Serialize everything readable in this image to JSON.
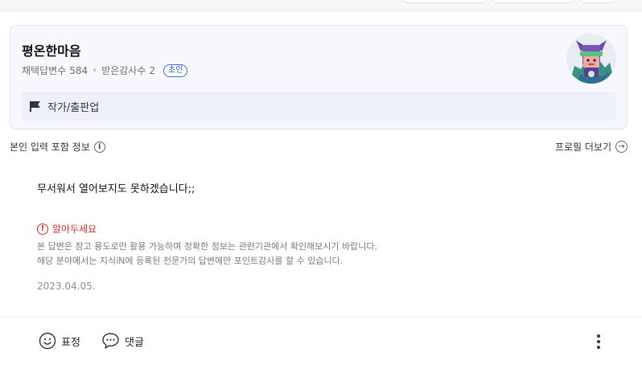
{
  "profile": {
    "name": "평온한마음",
    "adopted_label": "채택답변수",
    "adopted_count": "584",
    "thanks_label": "받은감사수",
    "thanks_count": "2",
    "rank_badge": "초인",
    "category": "작가/출판업",
    "category_icon": "flag-icon",
    "avatar": "character-avatar"
  },
  "info": {
    "self_input_label": "본인 입력 포함 정보",
    "info_icon": "info-icon",
    "more_profile_label": "프로필 더보기",
    "more_icon": "arrow-right-circle-icon"
  },
  "answer": {
    "body": "무서워서 열어보지도 못하겠습니다;;",
    "notice_title": "알아두세요",
    "notice_line1": "본 답변은 참고 용도로만 활용 가능하며 정확한 정보는 관련기관에서 확인해보시기 바랍니다.",
    "notice_line2": "해당 분야에서는 지식iN에 등록된 전문가의 답변에만 포인트감사를 할 수 있습니다.",
    "date": "2023.04.05."
  },
  "actions": {
    "emotion_label": "표정",
    "comment_label": "댓글",
    "emotion_icon": "smile-icon",
    "comment_icon": "speech-bubble-icon",
    "more_icon": "kebab-menu-icon"
  },
  "colors": {
    "warning": "#d9302c",
    "badge": "#3a6fd0",
    "card_bg": "#f7f8fd"
  }
}
